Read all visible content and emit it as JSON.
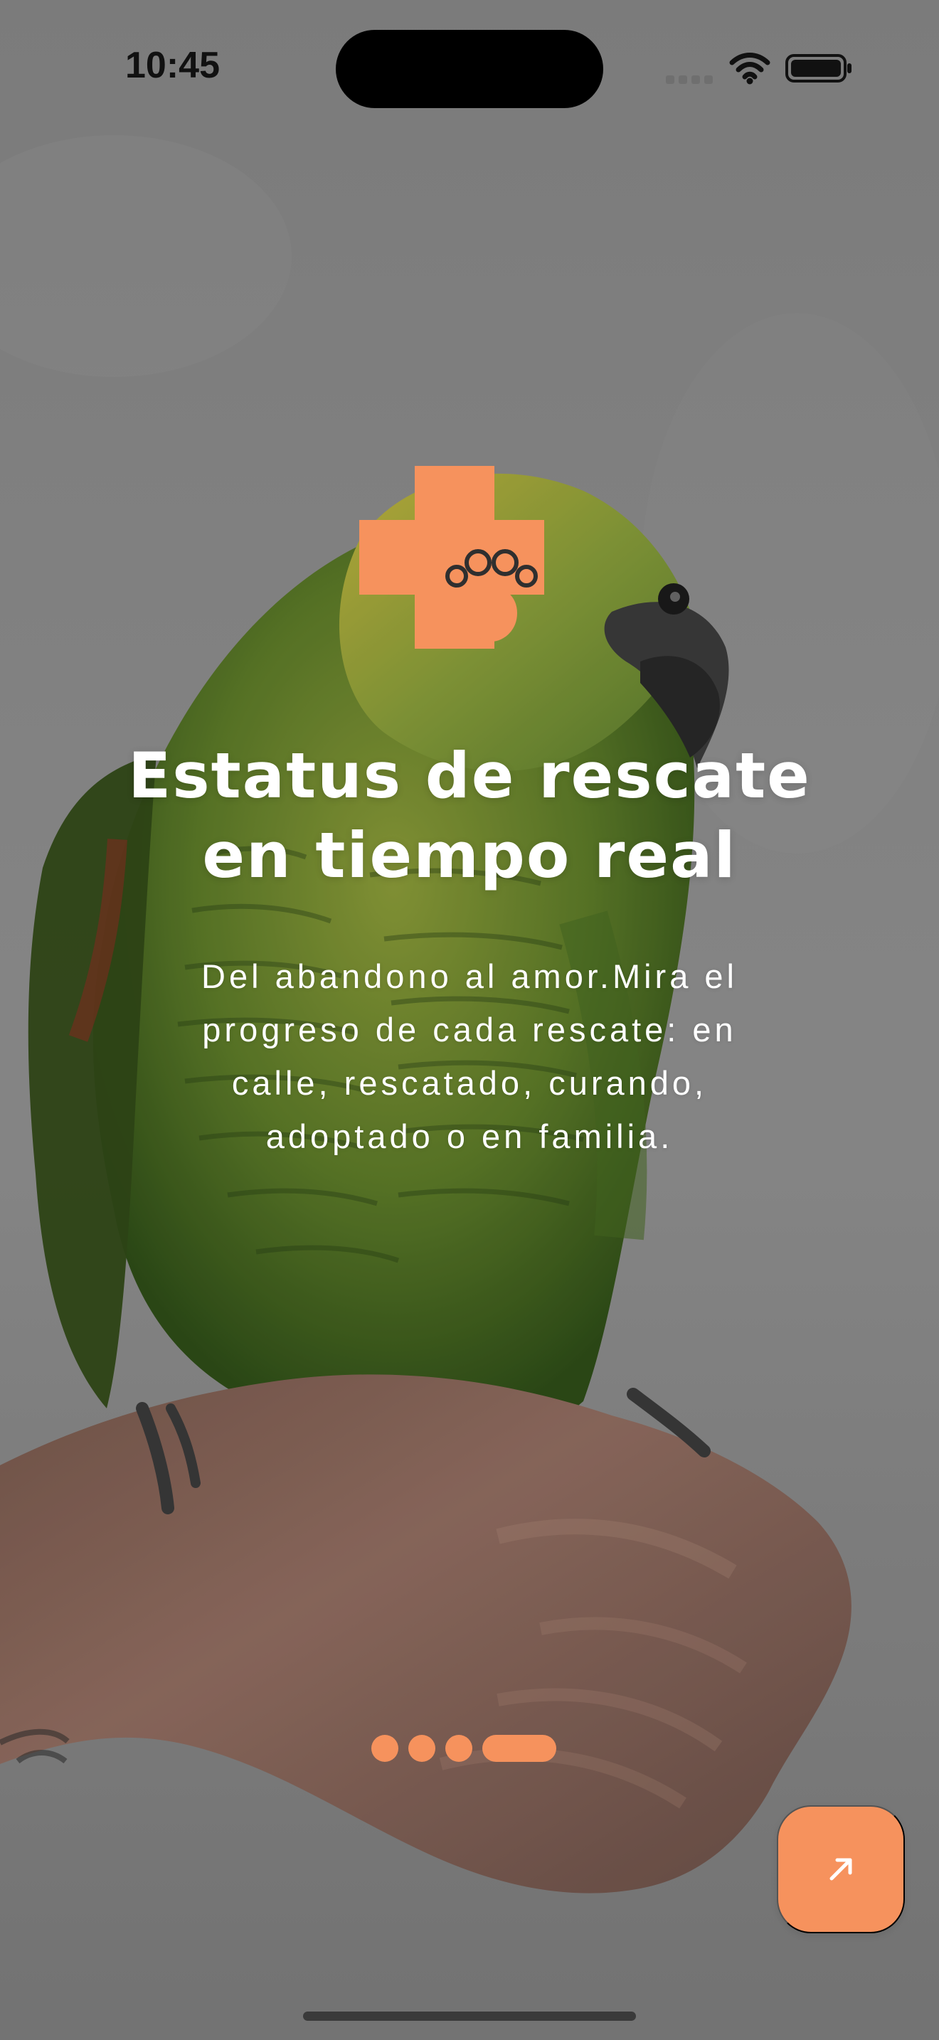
{
  "status_bar": {
    "time": "10:45"
  },
  "logo": {
    "icon": "medical-cross-paw-logo"
  },
  "main": {
    "title_lines": [
      "Estatus de rescate",
      "en tiempo real"
    ],
    "description_lines": [
      "Del abandono al amor.Mira el",
      "progreso de cada rescate: en",
      "calle, rescatado, curando,",
      "adoptado o en familia."
    ]
  },
  "pagination": {
    "total": 4,
    "active_index": 3
  },
  "controls": {
    "next_icon": "arrow-up-right-icon"
  },
  "colors": {
    "accent": "#f6925d",
    "background": "#8f8f8f",
    "text": "#ffffff"
  }
}
